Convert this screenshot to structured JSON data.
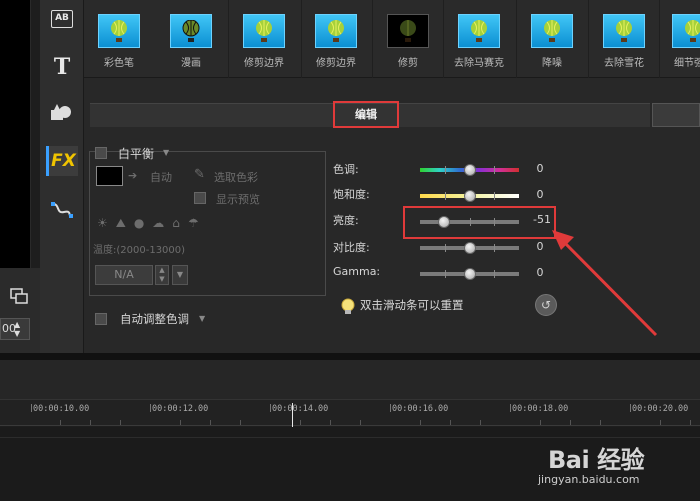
{
  "effects": [
    {
      "label": "彩色笔",
      "icon": "balloon-icon"
    },
    {
      "label": "漫画",
      "icon": "balloon-comic-icon"
    },
    {
      "label": "修剪边界",
      "icon": "balloon-icon"
    },
    {
      "label": "修剪边界",
      "icon": "balloon-icon"
    },
    {
      "label": "修剪",
      "icon": "balloon-dark-icon"
    },
    {
      "label": "去除马赛克",
      "icon": "balloon-icon"
    },
    {
      "label": "降噪",
      "icon": "balloon-icon"
    },
    {
      "label": "去除雪花",
      "icon": "balloon-icon"
    },
    {
      "label": "细节强",
      "icon": "balloon-icon"
    }
  ],
  "sidebar": {
    "ab_label": "AB",
    "text_label": "T",
    "fx_label": "FX"
  },
  "left": {
    "spin_value": "00"
  },
  "panel": {
    "title": "编辑",
    "white_balance": {
      "label": "白平衡",
      "auto": "自动",
      "pick_color": "选取色彩",
      "show_preview": "显示预览",
      "temperature": "温度:(2000-13000)",
      "temp_value": "N/A"
    },
    "auto_tone": "自动调整色调",
    "adjustments": [
      {
        "label": "色调:",
        "value": "0",
        "level": 0.5,
        "style": "hue"
      },
      {
        "label": "饱和度:",
        "value": "0",
        "level": 0.5,
        "style": "sat"
      },
      {
        "label": "亮度:",
        "value": "-51",
        "level": 0.245,
        "style": "gray"
      },
      {
        "label": "对比度:",
        "value": "0",
        "level": 0.5,
        "style": "gray"
      },
      {
        "label": "Gamma:",
        "value": "0",
        "level": 0.5,
        "style": "gray"
      }
    ],
    "hint": "双击滑动条可以重置"
  },
  "timeline": {
    "ticks": [
      "00:00:10.00",
      "00:00:12.00",
      "00:00:14.00",
      "00:00:16.00",
      "00:00:18.00",
      "00:00:20.00"
    ]
  },
  "watermark": {
    "main": "Bai 经验",
    "sub": "jingyan.baidu.com"
  },
  "colors": {
    "highlight": "#e03a3a",
    "accent": "#3aa0ff",
    "fx": "#f0c400"
  }
}
